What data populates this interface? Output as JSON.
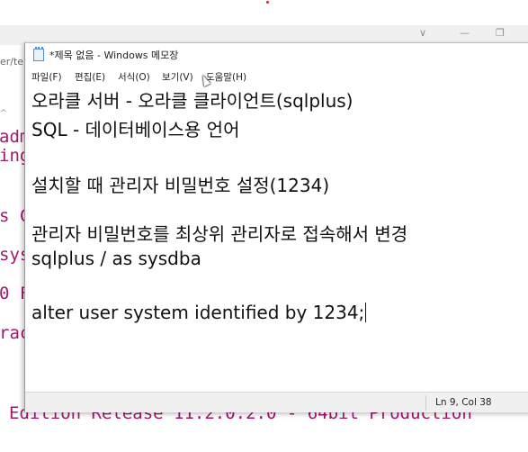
{
  "background_window": {
    "path_fragment": "er/te",
    "controls": {
      "minimize": "—",
      "maximize": "❐",
      "chevron": "∨"
    },
    "terminal_fragments": [
      "adm",
      "ing",
      "s C",
      "sys",
      "0 F",
      "rac"
    ],
    "bottom_line": "Edition Release 11.2.0.2.0 - 64bit Production",
    "text_color": "#a2176f"
  },
  "notepad": {
    "title": "*제목 없음 - Windows 메모장",
    "menu": [
      "파일(F)",
      "편집(E)",
      "서식(O)",
      "보기(V)",
      "도움말(H)"
    ],
    "lines": [
      "오라클 서버 - 오라클 클라이언트(sqlplus)",
      "SQL - 데이터베이스용 언어",
      "",
      "설치할 때 관리자 비밀번호 설정(1234)",
      "",
      "관리자 비밀번호를 최상위 관리자로 접속해서 변경",
      "sqlplus / as sysdba",
      "",
      "alter user system identified by 1234;"
    ],
    "status": "Ln 9, Col 38"
  }
}
